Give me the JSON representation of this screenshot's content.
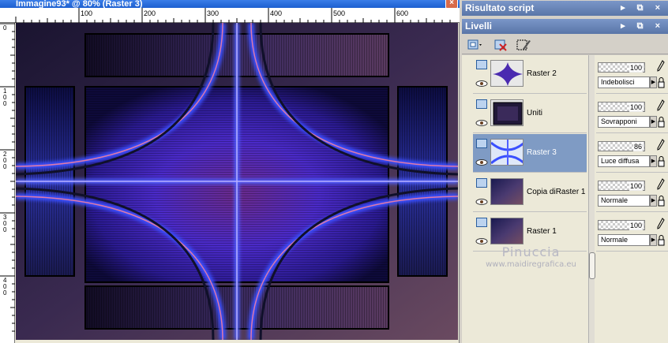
{
  "image_window": {
    "title": "Immagine93* @ 80% (Raster 3)",
    "close_glyph": "×",
    "ruler_top_labels": [
      "100",
      "200",
      "300",
      "400",
      "500",
      "600"
    ],
    "ruler_left_labels": [
      "0",
      "100",
      "200",
      "300",
      "400"
    ]
  },
  "dock": {
    "script_panel_title": "Risultato script",
    "layers_panel_title": "Livelli",
    "panel_buttons": "▸ ⧉ ×",
    "layers": [
      {
        "name": "Raster 2",
        "opacity": "100",
        "blend": "Indebolisci",
        "selected": false
      },
      {
        "name": "Uniti",
        "opacity": "100",
        "blend": "Sovrapponi",
        "selected": false
      },
      {
        "name": "Raster 3",
        "opacity": "86",
        "blend": "Luce diffusa",
        "selected": true
      },
      {
        "name": "Copia diRaster 1",
        "opacity": "100",
        "blend": "Normale",
        "selected": false
      },
      {
        "name": "Raster 1",
        "opacity": "100",
        "blend": "Normale",
        "selected": false
      }
    ]
  },
  "watermark": {
    "name": "Pinuccia",
    "site": "www.maidiregrafica.eu"
  },
  "colors": {
    "accent_blue": "#2d3cff",
    "accent_pink": "#e07aa8",
    "dark_navy": "#0e0a2a",
    "selection": "#7f9bc4"
  }
}
